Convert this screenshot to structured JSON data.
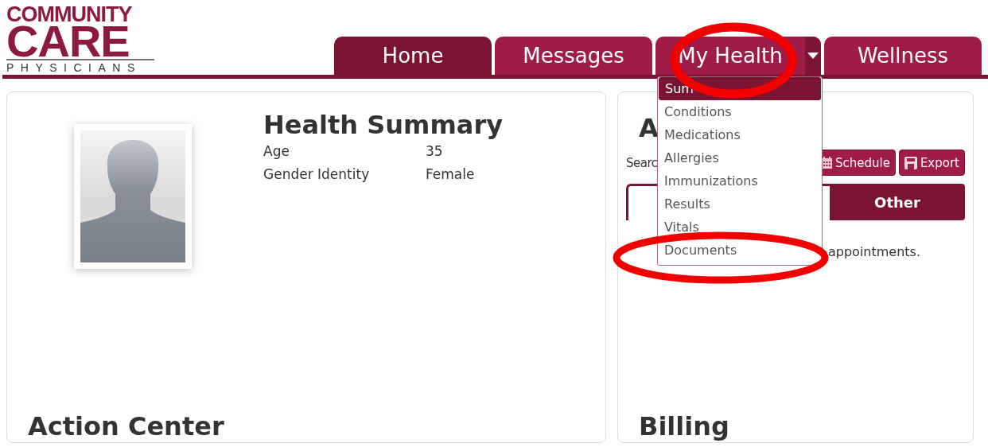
{
  "logo": {
    "line_1": "COMMUNITY",
    "line_2": "CARE",
    "line_3": "PHYSICIANS"
  },
  "nav_tabs": [
    {
      "label": "Home",
      "selected": true,
      "has_menu": false
    },
    {
      "label": "Messages",
      "selected": false,
      "has_menu": false
    },
    {
      "label": "My Health",
      "selected": false,
      "has_menu": true
    },
    {
      "label": "Wellness",
      "selected": false,
      "has_menu": false
    }
  ],
  "dropdown": {
    "items": [
      {
        "label": "Sum",
        "selected": true
      },
      {
        "label": "Conditions",
        "selected": false
      },
      {
        "label": "Medications",
        "selected": false
      },
      {
        "label": "Allergies",
        "selected": false
      },
      {
        "label": "Immunizations",
        "selected": false
      },
      {
        "label": "Results",
        "selected": false
      },
      {
        "label": "Vitals",
        "selected": false
      },
      {
        "label": "Documents",
        "selected": false
      }
    ]
  },
  "health_summary": {
    "title": "Health Summary",
    "fields": [
      {
        "label": "Age",
        "value": "35"
      },
      {
        "label": "Gender Identity",
        "value": "Female"
      }
    ]
  },
  "action_center": {
    "title": "Action Center"
  },
  "appointments": {
    "title": "A",
    "search_label": "Searc",
    "buttons": [
      {
        "label": "Schedule",
        "kind": "calendar"
      },
      {
        "label": "Export",
        "kind": "save"
      }
    ],
    "tabs": [
      {
        "label": "Other",
        "selected": false
      }
    ],
    "message": "appointments."
  },
  "billing": {
    "title": "Billing"
  }
}
